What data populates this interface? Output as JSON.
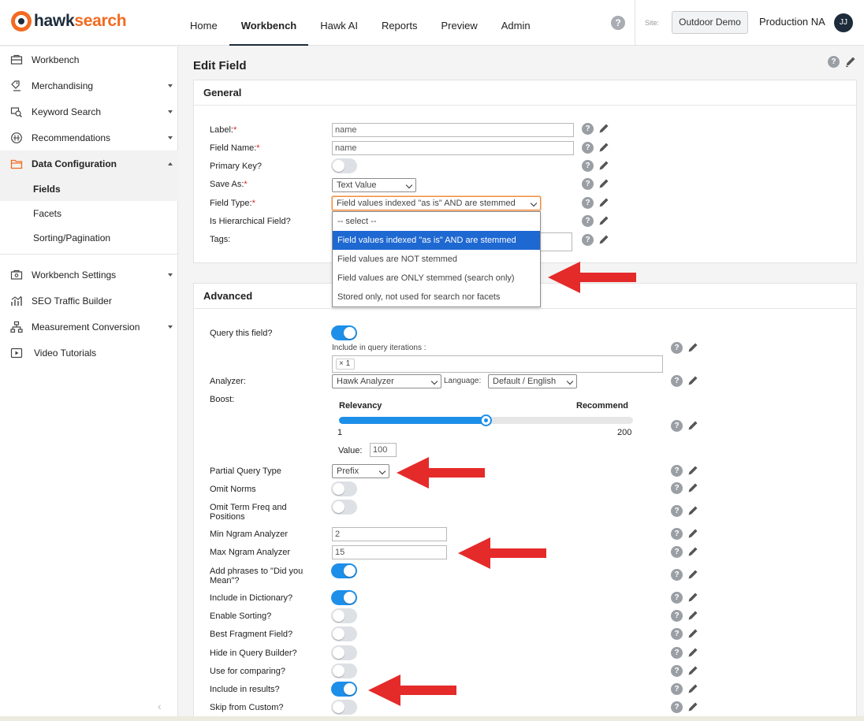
{
  "brand": {
    "name_part1": "hawk",
    "name_part2": "search",
    "primary_color": "#1d2b3a",
    "accent_color": "#f26b21"
  },
  "nav": {
    "items": [
      "Home",
      "Workbench",
      "Hawk AI",
      "Reports",
      "Preview",
      "Admin"
    ],
    "active": "Workbench"
  },
  "header": {
    "help": "?",
    "site_label": "Site:",
    "site_button": "Outdoor Demo",
    "environment": "Production NA",
    "user_initials": "JJ"
  },
  "sidebar": {
    "items": [
      {
        "label": "Workbench",
        "icon": "dashboard-icon"
      },
      {
        "label": "Merchandising",
        "icon": "merchandising-icon"
      },
      {
        "label": "Keyword Search",
        "icon": "keyword-search-icon"
      },
      {
        "label": "Recommendations",
        "icon": "recommendations-icon"
      },
      {
        "label": "Data Configuration",
        "icon": "folder-icon"
      },
      {
        "label": "Workbench Settings",
        "icon": "settings-icon"
      },
      {
        "label": "SEO Traffic Builder",
        "icon": "seo-icon"
      },
      {
        "label": "Measurement Conversion",
        "icon": "hierarchy-icon"
      },
      {
        "label": "Video Tutorials",
        "icon": "video-icon"
      }
    ],
    "sub_items": [
      "Fields",
      "Facets",
      "Sorting/Pagination"
    ],
    "active_sub": "Fields",
    "collapse": "‹"
  },
  "page": {
    "title": "Edit Field"
  },
  "general": {
    "title": "General",
    "label_label": "Label:",
    "label_value": "name",
    "field_name_label": "Field Name:",
    "field_name_value": "name",
    "primary_key_label": "Primary Key?",
    "save_as_label": "Save As:",
    "save_as_value": "Text Value",
    "field_type_label": "Field Type:",
    "field_type_value": "Field values indexed \"as is\" AND are stemmed",
    "hierarchical_label": "Is Hierarchical Field?",
    "tags_label": "Tags:",
    "field_type_options": [
      "-- select --",
      "Field values indexed \"as is\" AND are stemmed",
      "Field values are NOT stemmed",
      "Field values are ONLY stemmed (search only)",
      "Stored only, not used for search nor facets"
    ]
  },
  "advanced": {
    "title": "Advanced",
    "query_label": "Query this field?",
    "iterations_label": "Include in query iterations :",
    "iterations_chip": "1",
    "analyzer_label": "Analyzer:",
    "analyzer_value": "Hawk Analyzer",
    "language_label": "Language:",
    "language_value": "Default / English",
    "boost_label": "Boost:",
    "boost_left": "Relevancy",
    "boost_right": "Recommend",
    "boost_min": "1",
    "boost_max": "200",
    "boost_fraction": 0.5,
    "value_label": "Value:",
    "value": "100",
    "partial_query_label": "Partial Query Type",
    "partial_query_value": "Prefix",
    "omit_norms_label": "Omit Norms",
    "omit_term_label": "Omit Term Freq and Positions",
    "min_ngram_label": "Min Ngram Analyzer",
    "min_ngram_value": "2",
    "max_ngram_label": "Max Ngram Analyzer",
    "max_ngram_value": "15",
    "did_you_mean_label": "Add phrases to \"Did you Mean\"?",
    "dictionary_label": "Include in Dictionary?",
    "sorting_label": "Enable Sorting?",
    "fragment_label": "Best Fragment Field?",
    "hide_builder_label": "Hide in Query Builder?",
    "comparing_label": "Use for comparing?",
    "results_label": "Include in results?",
    "skip_custom_label": "Skip from Custom?"
  },
  "toggles": {
    "primary_key": false,
    "hierarchical": false,
    "query": true,
    "omit_norms": false,
    "omit_term": false,
    "did_you_mean": true,
    "dictionary": true,
    "sorting": false,
    "fragment": false,
    "hide_builder": false,
    "comparing": false,
    "results": true,
    "skip_custom": false
  },
  "colors": {
    "toggle_on": "#1d8fe9",
    "highlight": "#1e68d2",
    "arrow": "#e52a2a",
    "required": "#dd2222"
  }
}
